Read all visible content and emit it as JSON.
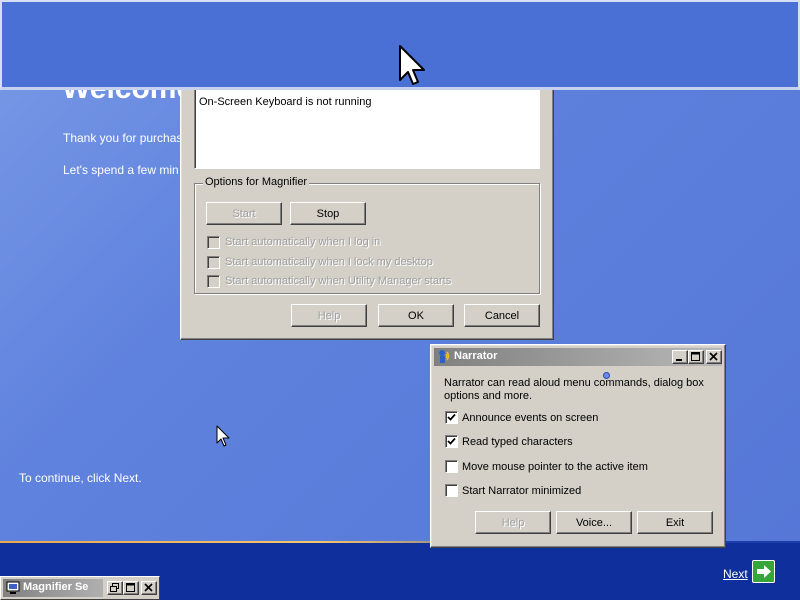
{
  "setup": {
    "welcome_title": "Welcome",
    "line1": "Thank you for purchas",
    "line2": "Let's spend a few min",
    "continue_text": "To continue, click Next.",
    "next_label": "Next"
  },
  "utility_manager": {
    "status_line": "On-Screen Keyboard is not running",
    "options_group_label": "Options for Magnifier",
    "start_button": "Start",
    "stop_button": "Stop",
    "options": [
      {
        "label": "Start automatically when I log in",
        "checked": false,
        "disabled": true
      },
      {
        "label": "Start automatically when I lock my desktop",
        "checked": false,
        "disabled": true
      },
      {
        "label": "Start automatically when Utility Manager starts",
        "checked": false,
        "disabled": true
      }
    ],
    "help_button": "Help",
    "ok_button": "OK",
    "cancel_button": "Cancel"
  },
  "narrator": {
    "title": "Narrator",
    "description": "Narrator can read aloud menu commands, dialog box options and more.",
    "options": [
      {
        "label": "Announce events on screen",
        "checked": true
      },
      {
        "label": "Read typed characters",
        "checked": true
      },
      {
        "label": "Move mouse pointer to the active item",
        "checked": false
      },
      {
        "label": "Start Narrator minimized",
        "checked": false
      }
    ],
    "help_button": "Help",
    "voice_button": "Voice...",
    "exit_button": "Exit"
  },
  "magnifier_taskbar": {
    "title": "Magnifier Se"
  },
  "colors": {
    "desktop_blue": "#5a7edc",
    "bottom_band": "#0e2f9c",
    "next_green": "#36a53a",
    "inactive_title": "#808080"
  },
  "icons": {
    "narrator": "narrator-icon",
    "next": "arrow-right-icon",
    "cursor": "arrow-cursor-icon"
  }
}
